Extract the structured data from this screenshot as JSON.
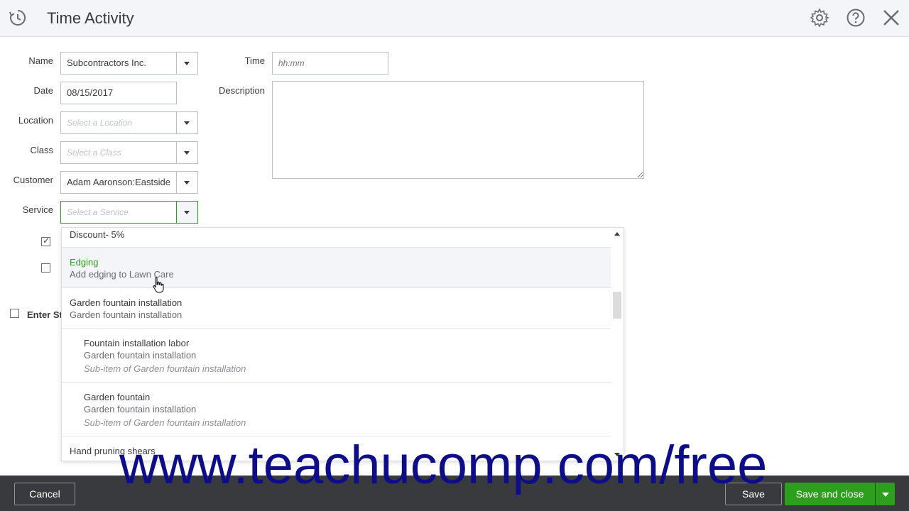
{
  "header": {
    "title": "Time Activity"
  },
  "form": {
    "name": {
      "label": "Name",
      "value": "Subcontractors Inc."
    },
    "date": {
      "label": "Date",
      "value": "08/15/2017"
    },
    "location": {
      "label": "Location",
      "placeholder": "Select a Location"
    },
    "class": {
      "label": "Class",
      "placeholder": "Select a Class"
    },
    "customer": {
      "label": "Customer",
      "value": "Adam Aaronson:Eastside"
    },
    "service": {
      "label": "Service",
      "placeholder": "Select a Service"
    },
    "time": {
      "label": "Time",
      "placeholder": "hh:mm"
    },
    "description": {
      "label": "Description"
    },
    "billable_checked": true,
    "taxable_checked": false,
    "enter_start_end": {
      "label": "Enter Sta",
      "checked": false
    }
  },
  "service_dropdown": {
    "options": [
      {
        "name": "Discount- 5%",
        "description": "",
        "sub": ""
      },
      {
        "name": "Edging",
        "description": "Add edging to Lawn Care",
        "sub": "",
        "highlighted": true
      },
      {
        "name": "Garden fountain installation",
        "description": "Garden fountain installation",
        "sub": ""
      },
      {
        "name": "Fountain installation labor",
        "description": "Garden fountain installation",
        "sub": "Sub-item of Garden fountain installation"
      },
      {
        "name": "Garden fountain",
        "description": "Garden fountain installation",
        "sub": "Sub-item of Garden fountain installation"
      },
      {
        "name": "Hand pruning shears",
        "description": "",
        "sub": ""
      }
    ]
  },
  "footer": {
    "cancel_label": "Cancel",
    "save_label": "Save",
    "save_close_label": "Save and close"
  },
  "watermark": "www.teachucomp.com/free",
  "colors": {
    "accent": "#2ca01c",
    "footer_bg": "#393a3d",
    "watermark": "#0d0d8a"
  }
}
